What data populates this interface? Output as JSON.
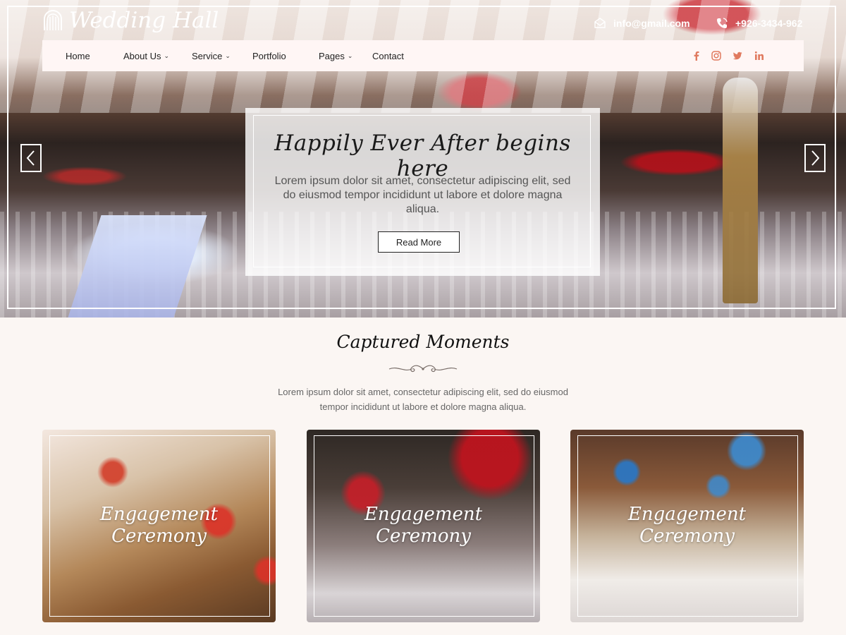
{
  "site": {
    "logo_text": "Wedding Hall",
    "email": "info@gmail.com",
    "phone": "+926-3434-962"
  },
  "nav": {
    "items": [
      {
        "label": "Home",
        "dropdown": false
      },
      {
        "label": "About Us",
        "dropdown": true
      },
      {
        "label": "Service",
        "dropdown": true
      },
      {
        "label": "Portfolio",
        "dropdown": false
      },
      {
        "label": "Pages",
        "dropdown": true
      },
      {
        "label": "Contact",
        "dropdown": false
      }
    ],
    "social": [
      "facebook-icon",
      "instagram-icon",
      "twitter-icon",
      "linkedin-icon"
    ],
    "social_color": "#e07a5f"
  },
  "hero": {
    "title": "Happily Ever After begins here",
    "text": "Lorem ipsum dolor sit amet, consectetur adipiscing elit, sed do eiusmod tempor incididunt ut labore et dolore magna aliqua.",
    "button": "Read More"
  },
  "moments": {
    "title": "Captured Moments",
    "text": "Lorem ipsum dolor sit amet, consectetur adipiscing elit, sed do eiusmod tempor incididunt ut labore et dolore magna aliqua.",
    "cards": [
      {
        "line1": "Engagement",
        "line2": "Ceremony"
      },
      {
        "line1": "Engagement",
        "line2": "Ceremony"
      },
      {
        "line1": "Engagement",
        "line2": "Ceremony"
      }
    ]
  }
}
